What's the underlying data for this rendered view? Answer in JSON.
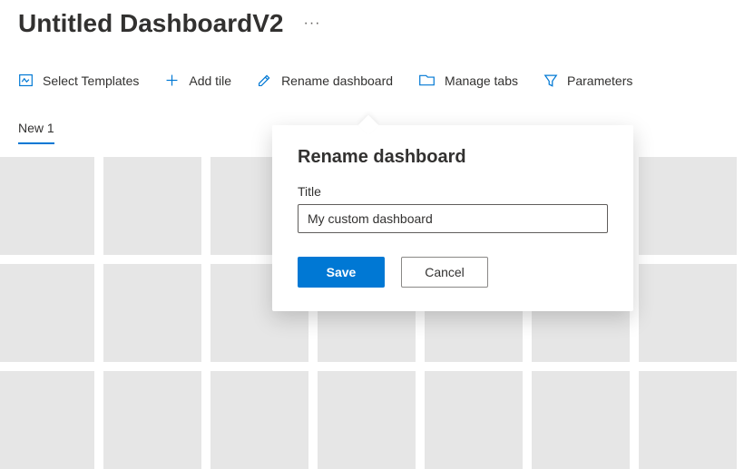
{
  "header": {
    "title": "Untitled DashboardV2",
    "more_glyph": "···"
  },
  "toolbar": {
    "select_templates": "Select Templates",
    "add_tile": "Add tile",
    "rename_dashboard": "Rename dashboard",
    "manage_tabs": "Manage tabs",
    "parameters": "Parameters"
  },
  "tabs": {
    "items": [
      {
        "label": "New 1",
        "active": true
      }
    ]
  },
  "dialog": {
    "title": "Rename dashboard",
    "field_label": "Title",
    "field_value": "My custom dashboard",
    "save_label": "Save",
    "cancel_label": "Cancel"
  },
  "colors": {
    "accent": "#0078d4",
    "tile": "#e6e6e6"
  }
}
